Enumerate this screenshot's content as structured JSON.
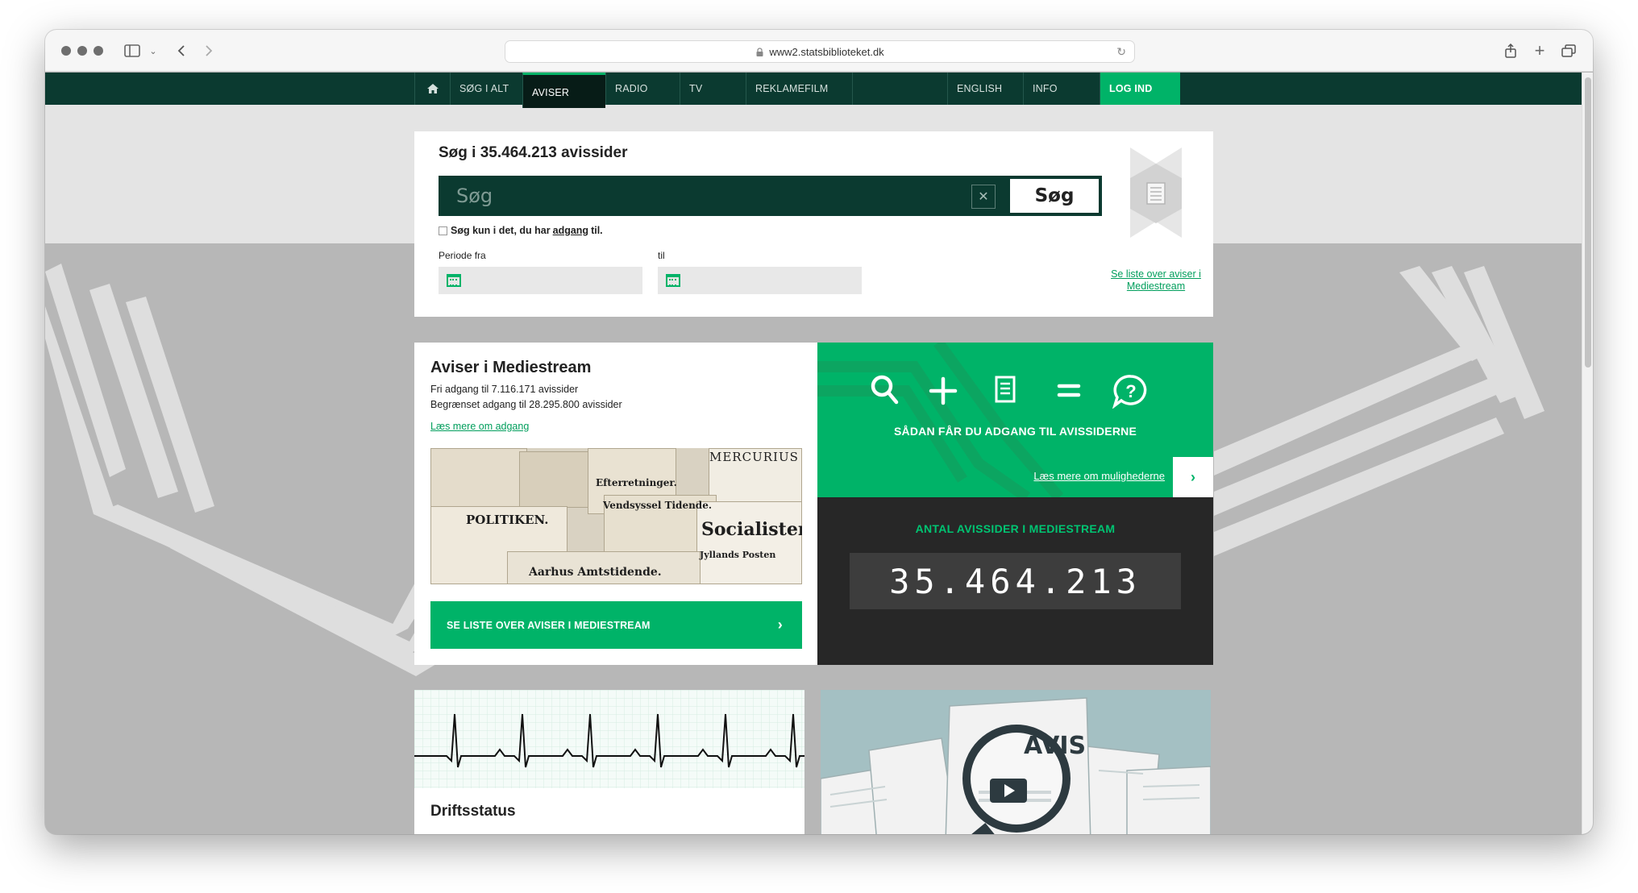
{
  "browser": {
    "url": "www2.statsbiblioteket.dk"
  },
  "nav": {
    "items": [
      {
        "label": "SØG I ALT"
      },
      {
        "label": "AVISER"
      },
      {
        "label": "RADIO"
      },
      {
        "label": "TV"
      },
      {
        "label": "REKLAMEFILM"
      },
      {
        "label": "ENGLISH"
      },
      {
        "label": "INFO"
      },
      {
        "label": "LOG IND"
      }
    ],
    "active": "AVISER"
  },
  "search": {
    "title": "Søg i 35.464.213 avissider",
    "placeholder": "Søg",
    "button": "Søg",
    "access_prefix": "Søg kun i det, du har",
    "access_link": "adgang",
    "access_suffix": "til.",
    "period_from": "Periode fra",
    "period_to": "til",
    "see_list": "Se liste over aviser i Mediestream"
  },
  "newspapers": {
    "title": "Aviser i Mediestream",
    "free": "Fri adgang til 7.116.171 avissider",
    "limited": "Begrænset adgang til 28.295.800 avissider",
    "more_link": "Læs mere om adgang",
    "mastheads": [
      "POLITIKEN.",
      "MERCURIUS",
      "Vendsyssel Tidende.",
      "Socialisten.",
      "Aarhus Amtstidende.",
      "Jyllands Posten",
      "Efterretninger."
    ],
    "list_button": "SE LISTE OVER AVISER I MEDIESTREAM"
  },
  "access": {
    "heading": "SÅDAN FÅR DU ADGANG TIL AVISSIDERNE",
    "link": "Læs mere om mulighederne"
  },
  "counter": {
    "heading": "ANTAL AVISSIDER I MEDIESTREAM",
    "value": "35.464.213"
  },
  "drift": {
    "title": "Driftsstatus"
  },
  "video": {
    "label": "AVIS"
  },
  "colors": {
    "brand_dark": "#0b3a30",
    "brand_green": "#00b368",
    "counter_bg": "#272727"
  }
}
